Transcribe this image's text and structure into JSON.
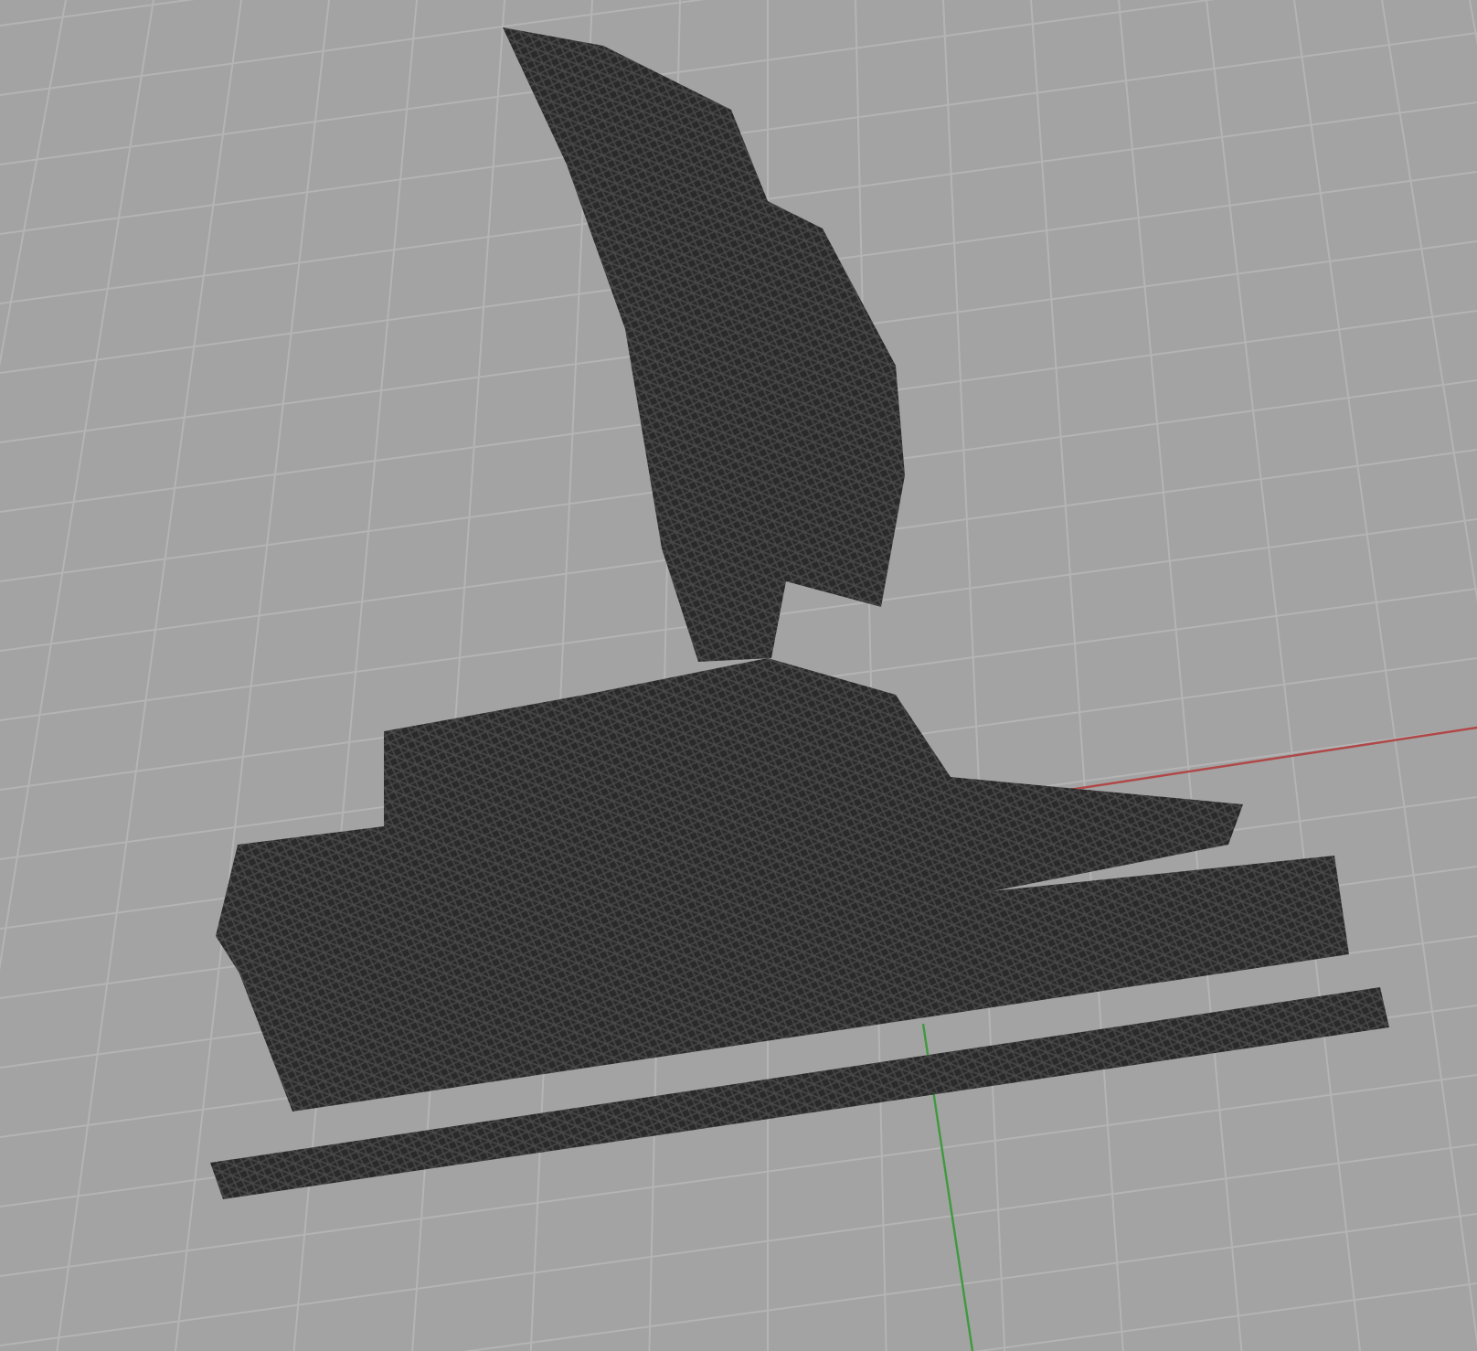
{
  "viewport": {
    "axes": [
      {
        "kind": "x",
        "color": "#b04848"
      },
      {
        "kind": "y",
        "color": "#3f9a3f"
      }
    ]
  }
}
